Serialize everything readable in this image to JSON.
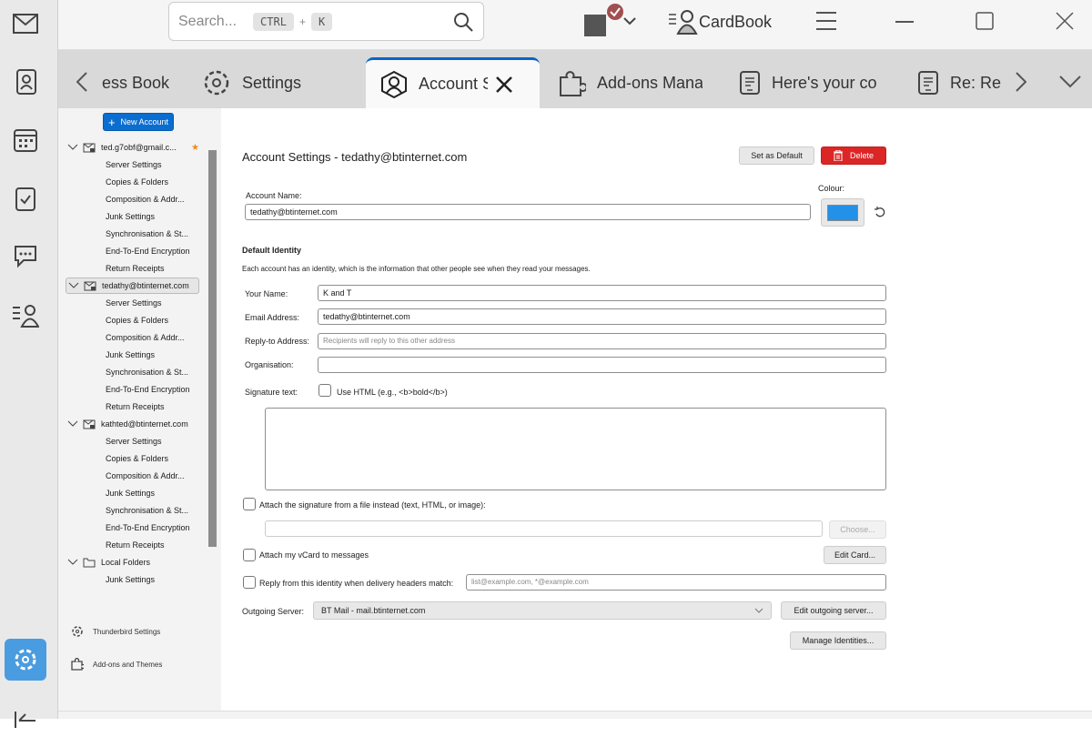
{
  "toolbar": {
    "search_placeholder": "Search...",
    "shortcut_ctrl": "CTRL",
    "shortcut_plus": "+",
    "shortcut_key": "K",
    "cardbook_label": "CardBook"
  },
  "tabs": [
    {
      "label": "ess Book"
    },
    {
      "label": "Settings"
    },
    {
      "label": "Account S"
    },
    {
      "label": "Add-ons Mana"
    },
    {
      "label": "Here's your co"
    },
    {
      "label": "Re: Re"
    }
  ],
  "sidebar": {
    "new_account": "New Account",
    "accounts": [
      {
        "name": "ted.g7obf@gmail.c...",
        "items": [
          "Server Settings",
          "Copies & Folders",
          "Composition & Addr...",
          "Junk Settings",
          "Synchronisation & St...",
          "End-To-End Encryption",
          "Return Receipts"
        ]
      },
      {
        "name": "tedathy@btinternet.com",
        "items": [
          "Server Settings",
          "Copies & Folders",
          "Composition & Addr...",
          "Junk Settings",
          "Synchronisation & St...",
          "End-To-End Encryption",
          "Return Receipts"
        ]
      },
      {
        "name": "kathted@btinternet.com",
        "items": [
          "Server Settings",
          "Copies & Folders",
          "Composition & Addr...",
          "Junk Settings",
          "Synchronisation & St...",
          "End-To-End Encryption",
          "Return Receipts"
        ]
      },
      {
        "name": "Local Folders",
        "items": [
          "Junk Settings"
        ]
      }
    ],
    "thunderbird_settings": "Thunderbird Settings",
    "addons_themes": "Add-ons and Themes"
  },
  "main": {
    "title": "Account Settings - tedathy@btinternet.com",
    "set_default": "Set as Default",
    "delete": "Delete",
    "account_name_label": "Account Name:",
    "account_name": "tedathy@btinternet.com",
    "colour_label": "Colour:",
    "colour": "#2491e8",
    "default_identity": "Default Identity",
    "identity_desc": "Each account has an identity, which is the information that other people see when they read your messages.",
    "your_name_label": "Your Name:",
    "your_name": "K and T",
    "email_label": "Email Address:",
    "email": "tedathy@btinternet.com",
    "reply_to_label": "Reply-to Address:",
    "reply_to_placeholder": "Recipients will reply to this other address",
    "org_label": "Organisation:",
    "sig_label": "Signature text:",
    "use_html": "Use HTML (e.g., <b>bold</b>)",
    "attach_sig": "Attach the signature from a file instead (text, HTML, or image):",
    "choose": "Choose...",
    "attach_vcard": "Attach my vCard to messages",
    "edit_card": "Edit Card...",
    "reply_from": "Reply from this identity when delivery headers match:",
    "reply_from_placeholder": "list@example.com, *@example.com",
    "outgoing_label": "Outgoing Server:",
    "outgoing_value": "BT Mail - mail.btinternet.com",
    "edit_outgoing": "Edit outgoing server...",
    "manage_identities": "Manage Identities..."
  }
}
